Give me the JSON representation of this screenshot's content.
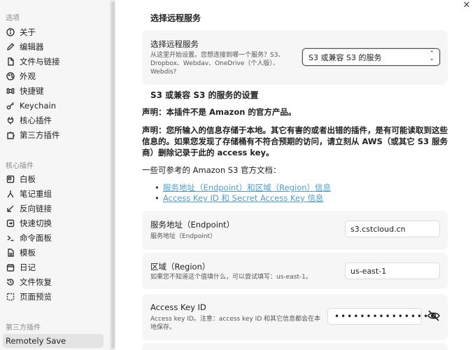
{
  "sidebar": {
    "section_options": "选项",
    "options": [
      {
        "label": "关于",
        "icon": "info-icon"
      },
      {
        "label": "编辑器",
        "icon": "pencil-icon"
      },
      {
        "label": "文件与链接",
        "icon": "file-icon"
      },
      {
        "label": "外观",
        "icon": "palette-icon"
      },
      {
        "label": "快捷键",
        "icon": "command-icon"
      },
      {
        "label": "Keychain",
        "icon": "key-icon"
      },
      {
        "label": "核心插件",
        "icon": "plug-icon"
      },
      {
        "label": "第三方插件",
        "icon": "puzzle-icon"
      }
    ],
    "section_core": "核心插件",
    "core": [
      {
        "label": "白板",
        "icon": "canvas-icon"
      },
      {
        "label": "笔记重组",
        "icon": "merge-icon"
      },
      {
        "label": "反向链接",
        "icon": "backlink-icon"
      },
      {
        "label": "快速切换",
        "icon": "switch-icon"
      },
      {
        "label": "命令面板",
        "icon": "terminal-icon"
      },
      {
        "label": "模板",
        "icon": "template-icon"
      },
      {
        "label": "日记",
        "icon": "calendar-icon"
      },
      {
        "label": "文件恢复",
        "icon": "history-icon"
      },
      {
        "label": "页面预览",
        "icon": "preview-icon"
      }
    ],
    "section_third": "第三方插件",
    "third": [
      {
        "label": "Remotely Save"
      }
    ]
  },
  "main": {
    "heading_choose": "选择远程服务",
    "choose_card": {
      "name": "选择远程服务",
      "desc_line1": "从这里开始设置。您想连接到哪一个服务？S3、",
      "desc_line2": "Dropbox、Webdav、OneDrive（个人版）、",
      "desc_line3": "Webdis?",
      "selected": "S3 或兼容 S3 的服务"
    },
    "heading_s3": "S3 或兼容 S3 的服务的设置",
    "statement1": "声明：本插件不是 Amazon 的官方产品。",
    "statement2_line1": "声明：您所输入的信息存储于本地。其它有害的或者出错的插件，是有可能读取到这些",
    "statement2_line2": "信息的。如果您发现了存储桶有不符合预期的访问，请立刻从 AWS（或其它 S3 服务",
    "statement2_line3": "商）删除记录于此的 access key。",
    "docs_intro": "一些可参考的 Amazon S3 官方文档：",
    "doc_links": [
      "服务地址（Endpoint）和区域（Region）信息",
      "Access Key ID 和 Secret Access Key 信息"
    ],
    "endpoint": {
      "name": "服务地址（Endpoint）",
      "desc": "服务地址（Endpoint）",
      "value": "s3.cstcloud.cn"
    },
    "region": {
      "name": "区域（Region）",
      "desc": "如果您不知道这个值填什么，可以尝试填写：us-east-1。",
      "value": "us-east-1"
    },
    "access_key": {
      "name": "Access Key ID",
      "desc_line1": "Access key ID。注意：access key ID 和其它信息都会在本",
      "desc_line2": "地保存。",
      "masked_value": "••••••••••••••••"
    }
  },
  "close_glyph": "✕"
}
